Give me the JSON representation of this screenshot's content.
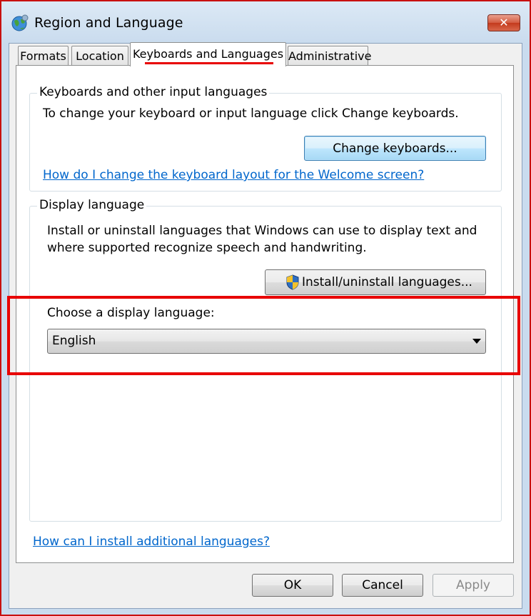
{
  "window": {
    "title": "Region and Language",
    "icon": "globe-icon",
    "close_label": "✕"
  },
  "tabs": [
    {
      "label": "Formats",
      "active": false
    },
    {
      "label": "Location",
      "active": false
    },
    {
      "label": "Keyboards and Languages",
      "active": true
    },
    {
      "label": "Administrative",
      "active": false
    }
  ],
  "keyboards_group": {
    "label": "Keyboards and other input languages",
    "description": "To change your keyboard or input language click Change keyboards.",
    "change_button": "Change keyboards...",
    "welcome_link": "How do I change the keyboard layout for the Welcome screen?"
  },
  "display_group": {
    "label": "Display language",
    "description_line1": "Install or uninstall languages that Windows can use to display text and",
    "description_line2": "where supported recognize speech and handwriting.",
    "install_button": "Install/uninstall languages...",
    "choose_label": "Choose a display language:",
    "selected_language": "English"
  },
  "footer": {
    "install_link": "How can I install additional languages?",
    "ok": "OK",
    "cancel": "Cancel",
    "apply": "Apply"
  },
  "colors": {
    "highlight": "#e80000",
    "link": "#0066cc"
  }
}
